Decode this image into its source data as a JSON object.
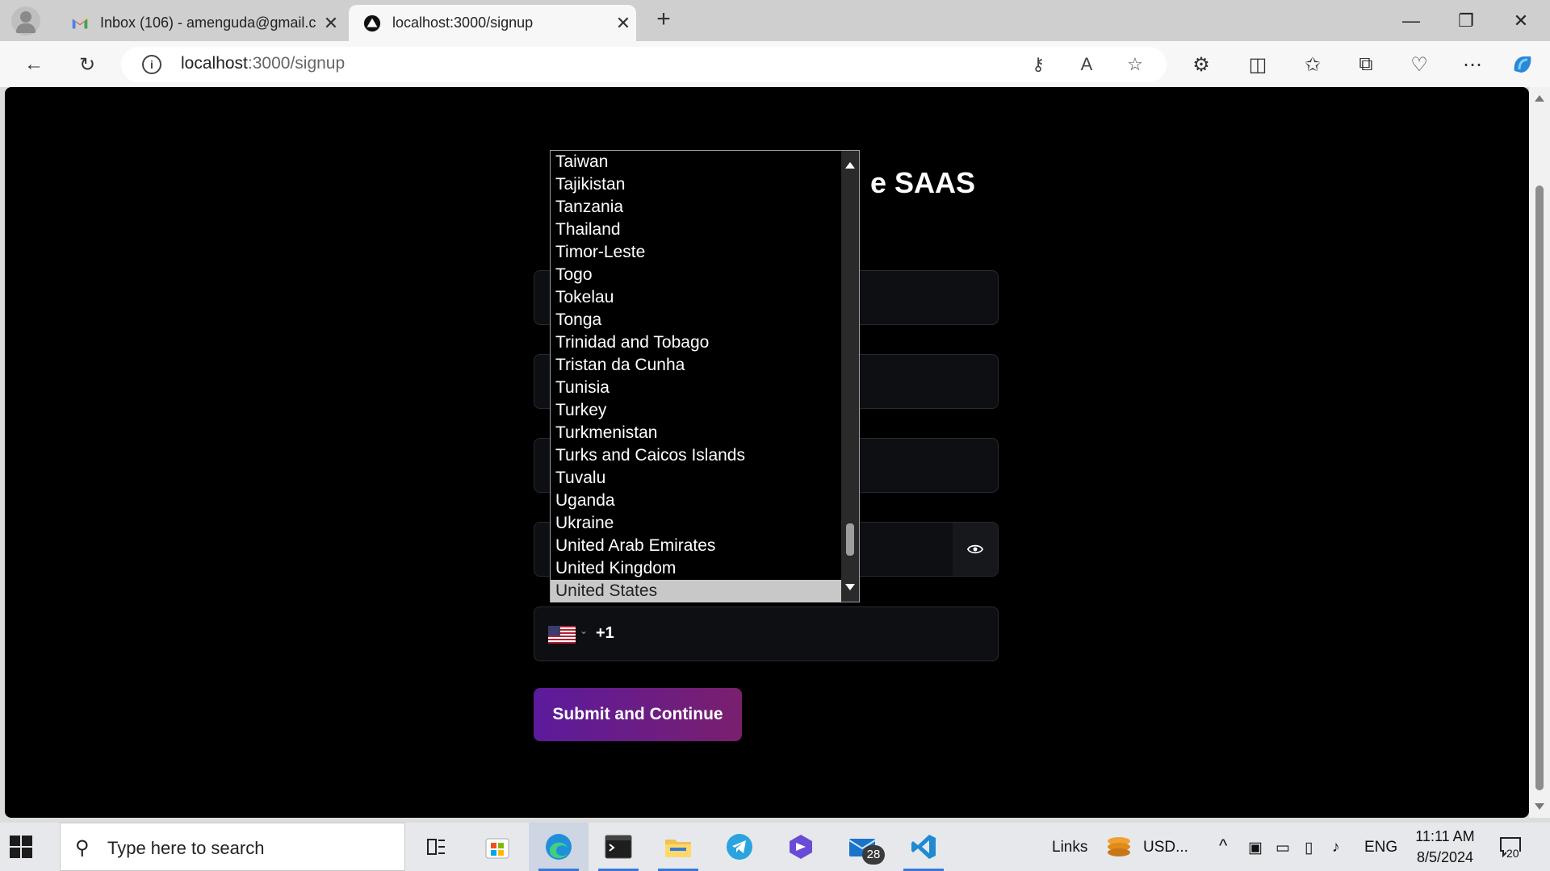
{
  "browser": {
    "tabs": [
      {
        "title": "Inbox (106) - amenguda@gmail.c",
        "icon": "gmail-icon"
      },
      {
        "title": "localhost:3000/signup",
        "icon": "app-logo-icon"
      }
    ],
    "url_host": "localhost",
    "url_rest": ":3000/signup"
  },
  "page": {
    "heading_fragment": "e SAAS",
    "phone_code": "+1",
    "submit_label": "Submit and Continue"
  },
  "country_dropdown": {
    "options": [
      "Taiwan",
      "Tajikistan",
      "Tanzania",
      "Thailand",
      "Timor-Leste",
      "Togo",
      "Tokelau",
      "Tonga",
      "Trinidad and Tobago",
      "Tristan da Cunha",
      "Tunisia",
      "Turkey",
      "Turkmenistan",
      "Turks and Caicos Islands",
      "Tuvalu",
      "Uganda",
      "Ukraine",
      "United Arab Emirates",
      "United Kingdom",
      "United States"
    ],
    "selected": "United States"
  },
  "taskbar": {
    "search_placeholder": "Type here to search",
    "links_label": "Links",
    "stock_label": "USD...",
    "language": "ENG",
    "time": "11:11 AM",
    "date": "8/5/2024",
    "mail_badge": "28",
    "notification_count": "20"
  },
  "colors": {
    "page_bg": "#000000",
    "field_bg": "#0d0f12",
    "submit_gradient_start": "#5b1b9c",
    "submit_gradient_end": "#7a1f6e",
    "selected_option_bg": "#c8c8c8"
  }
}
